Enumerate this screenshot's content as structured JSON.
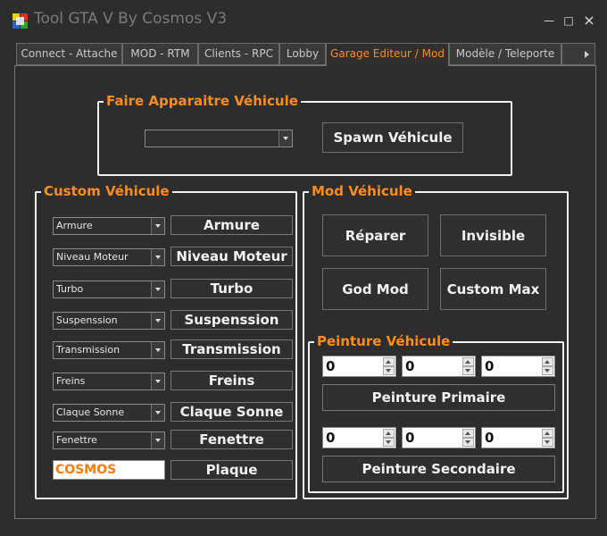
{
  "window": {
    "title": "Tool GTA V By Cosmos V3",
    "controls": {
      "minimize": "—",
      "maximize": "□",
      "close": "×"
    }
  },
  "tabs": [
    {
      "label": "Connect - Attache"
    },
    {
      "label": "MOD - RTM"
    },
    {
      "label": "Clients - RPC"
    },
    {
      "label": "Lobby"
    },
    {
      "label": "Garage Editeur / Mod",
      "active": true
    },
    {
      "label": "Modèle / Teleporte"
    }
  ],
  "spawn": {
    "legend": "Faire Apparaitre Véhicule",
    "combo_value": "",
    "button": "Spawn Véhicule"
  },
  "custom": {
    "legend": "Custom Véhicule",
    "rows": [
      {
        "combo": "Armure",
        "button": "Armure"
      },
      {
        "combo": "Niveau Moteur",
        "button": "Niveau Moteur"
      },
      {
        "combo": "Turbo",
        "button": "Turbo"
      },
      {
        "combo": "Suspenssion",
        "button": "Suspenssion"
      },
      {
        "combo": "Transmission",
        "button": "Transmission"
      },
      {
        "combo": "Freins",
        "button": "Freins"
      },
      {
        "combo": "Claque Sonne",
        "button": "Claque Sonne"
      },
      {
        "combo": "Fenettre",
        "button": "Fenettre"
      }
    ],
    "plaque_value": "COSMOS",
    "plaque_button": "Plaque"
  },
  "mod": {
    "legend": "Mod Véhicule",
    "buttons": [
      "Réparer",
      "Invisible",
      "God Mod",
      "Custom Max"
    ]
  },
  "peinture": {
    "legend": "Peinture Véhicule",
    "primary_values": [
      "0",
      "0",
      "0"
    ],
    "primary_button": "Peinture Primaire",
    "secondary_values": [
      "0",
      "0",
      "0"
    ],
    "secondary_button": "Peinture Secondaire"
  },
  "colors": {
    "accent": "#ff8c1a",
    "background": "#2d2d2d",
    "border": "#f0f0f0"
  }
}
